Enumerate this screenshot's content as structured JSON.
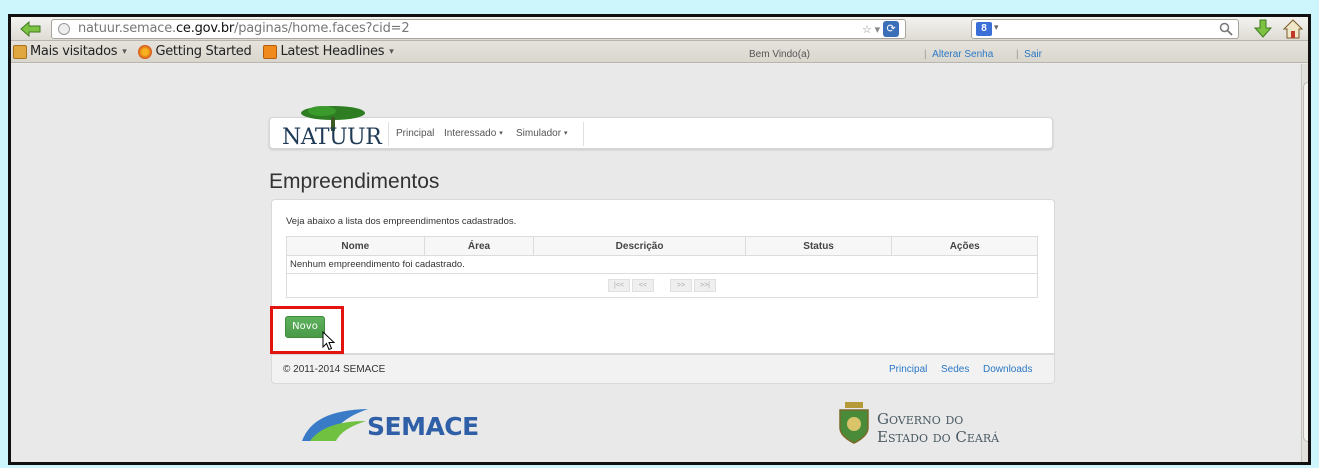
{
  "browser": {
    "url_prefix": "natuur.semace.",
    "url_domain": "ce.gov.br",
    "url_path": "/paginas/home.faces?cid=2",
    "search_engine_label": "8"
  },
  "bookmarks": [
    {
      "label": "Mais visitados",
      "has_dropdown": true,
      "icon": "folder-icon"
    },
    {
      "label": "Getting Started",
      "has_dropdown": false,
      "icon": "firefox-icon"
    },
    {
      "label": "Latest Headlines",
      "has_dropdown": true,
      "icon": "rss-icon"
    }
  ],
  "header": {
    "welcome": "Bem Vindo(a)",
    "alterar_senha": "Alterar Senha",
    "sair": "Sair"
  },
  "nav": {
    "logo": "NATUUR",
    "items": [
      {
        "label": "Principal"
      },
      {
        "label": "Interessado",
        "caret": "▾"
      },
      {
        "label": "Simulador",
        "caret": "▾"
      }
    ]
  },
  "page": {
    "title": "Empreendimentos",
    "description": "Veja abaixo a lista dos empreendimentos cadastrados."
  },
  "table": {
    "columns": [
      "Nome",
      "Área",
      "Descrição",
      "Status",
      "Ações"
    ],
    "empty_message": "Nenhum empreendimento foi cadastrado."
  },
  "pager": {
    "first": "|<<",
    "prev": "<<",
    "next": ">>",
    "last": ">>|"
  },
  "actions": {
    "novo_label": "Novo"
  },
  "footer": {
    "copyright": "© 2011-2014 SEMACE",
    "links": [
      "Principal",
      "Sedes",
      "Downloads"
    ]
  },
  "logos": {
    "semace": "SEMACE",
    "gov_line1": "Governo do",
    "gov_line2": "Estado do Ceará"
  },
  "colors": {
    "accent_green": "#4a9a48",
    "link_blue": "#2a78c6",
    "highlight_red": "#e3130d",
    "page_bg": "#ccf6fb"
  }
}
